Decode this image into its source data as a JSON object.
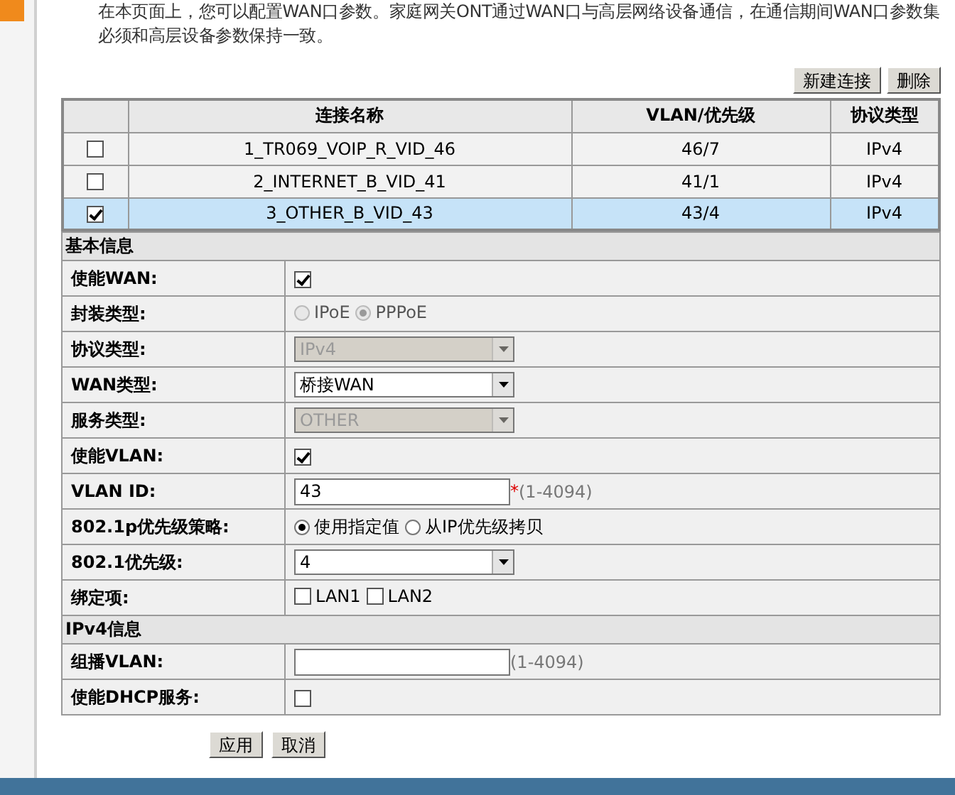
{
  "intro": "在本页面上，您可以配置WAN口参数。家庭网关ONT通过WAN口与高层网络设备通信，在通信期间WAN口参数集必须和高层设备参数保持一致。",
  "toolbar": [
    "新建连接",
    "删除"
  ],
  "table": {
    "columns": [
      "连接名称",
      "VLAN/优先级",
      "协议类型"
    ],
    "rows": [
      {
        "name": "1_TR069_VOIP_R_VID_46",
        "vlan": "46/7",
        "protocol": "IPv4",
        "checked": false,
        "selected": false
      },
      {
        "name": "2_INTERNET_B_VID_41",
        "vlan": "41/1",
        "protocol": "IPv4",
        "checked": false,
        "selected": false
      },
      {
        "name": "3_OTHER_B_VID_43",
        "vlan": "43/4",
        "protocol": "IPv4",
        "checked": true,
        "selected": true
      }
    ]
  },
  "sections": [
    {
      "title": "基本信息",
      "rows": [
        {
          "kind": "checkbox",
          "label": "使能WAN:",
          "checked": true
        },
        {
          "kind": "radio",
          "label": "封装类型:",
          "disabled": true,
          "options": [
            {
              "label": "IPoE",
              "selected": false
            },
            {
              "label": "PPPoE",
              "selected": true
            }
          ]
        },
        {
          "kind": "select",
          "label": "协议类型:",
          "value": "IPv4",
          "disabled": true
        },
        {
          "kind": "select",
          "label": "WAN类型:",
          "value": "桥接WAN",
          "disabled": false
        },
        {
          "kind": "select",
          "label": "服务类型:",
          "value": "OTHER",
          "disabled": true
        },
        {
          "kind": "checkbox",
          "label": "使能VLAN:",
          "checked": true
        },
        {
          "kind": "text",
          "label": "VLAN ID:",
          "value": "43",
          "mark": "*",
          "hint": "(1-4094)"
        },
        {
          "kind": "radio",
          "label": "802.1p优先级策略:",
          "disabled": false,
          "options": [
            {
              "label": "使用指定值",
              "selected": true
            },
            {
              "label": "从IP优先级拷贝",
              "selected": false
            }
          ]
        },
        {
          "kind": "select",
          "label": "802.1优先级:",
          "value": "4",
          "disabled": false
        },
        {
          "kind": "checks",
          "label": "绑定项:",
          "options": [
            {
              "label": "LAN1",
              "checked": false
            },
            {
              "label": "LAN2",
              "checked": false
            }
          ]
        }
      ]
    },
    {
      "title": "IPv4信息",
      "rows": [
        {
          "kind": "text",
          "label": "组播VLAN:",
          "value": "",
          "hint": "(1-4094)"
        },
        {
          "kind": "checkbox",
          "label": "使能DHCP服务:",
          "checked": false
        }
      ]
    }
  ],
  "actions": [
    "应用",
    "取消"
  ]
}
